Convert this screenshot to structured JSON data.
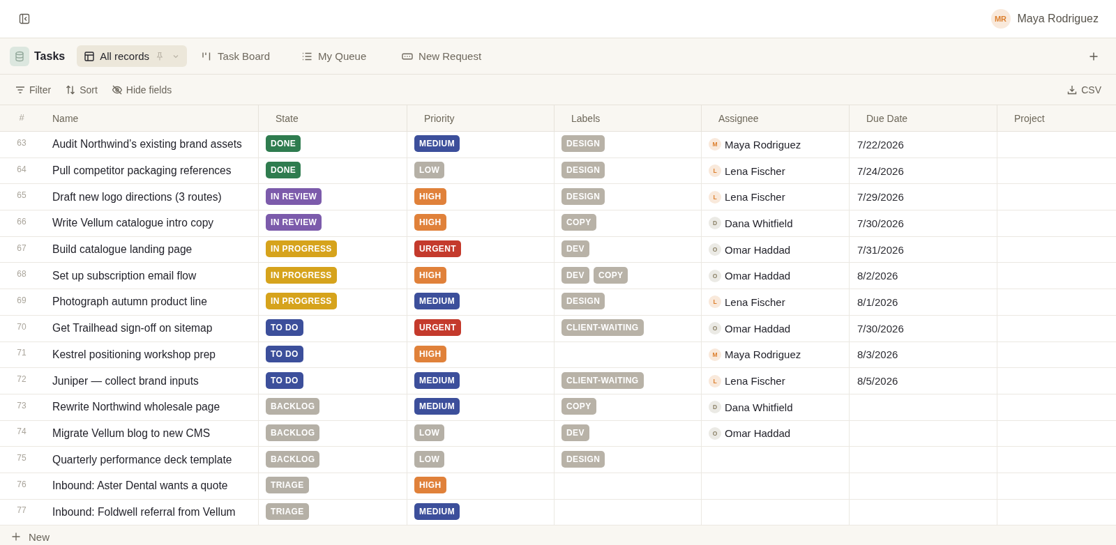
{
  "top_bar": {
    "user": {
      "initials": "MR",
      "name": "Maya Rodriguez",
      "color": "#dc7f2e"
    }
  },
  "views": {
    "title": "Tasks",
    "tabs": [
      {
        "label": "All records",
        "kind": "table",
        "selected": true,
        "pinned": true
      },
      {
        "label": "Task Board",
        "kind": "board",
        "selected": false,
        "pinned": false
      },
      {
        "label": "My Queue",
        "kind": "list",
        "selected": false,
        "pinned": false
      },
      {
        "label": "New Request",
        "kind": "form",
        "selected": false,
        "pinned": false
      }
    ]
  },
  "toolbar": {
    "actions": [
      {
        "label": "Filter",
        "kind": "filter"
      },
      {
        "label": "Sort",
        "kind": "sort"
      },
      {
        "label": "Hide fields",
        "kind": "hide"
      }
    ],
    "export_label": "CSV"
  },
  "table": {
    "columns": [
      "#",
      "Name",
      "State",
      "Priority",
      "Labels",
      "Assignee",
      "Due Date",
      "Project"
    ],
    "rows": [
      {
        "number": "63",
        "name": "Audit Northwind’s existing brand assets",
        "state": {
          "text": "DONE",
          "color": "#2f7c4f"
        },
        "priority": {
          "text": "MEDIUM",
          "color": "#3c4f9b"
        },
        "labels": [
          "DESIGN"
        ],
        "assignee": {
          "initial": "M",
          "name": "Maya Rodriguez",
          "color": "#dc7f2e"
        },
        "due_date": "7/22/2026"
      },
      {
        "number": "64",
        "name": "Pull competitor packaging references",
        "state": {
          "text": "DONE",
          "color": "#2f7c4f"
        },
        "priority": {
          "text": "LOW",
          "color": "#b5b0a6"
        },
        "labels": [
          "DESIGN"
        ],
        "assignee": {
          "initial": "L",
          "name": "Lena Fischer",
          "color": "#dc7f2e"
        },
        "due_date": "7/24/2026"
      },
      {
        "number": "65",
        "name": "Draft new logo directions (3 routes)",
        "state": {
          "text": "IN REVIEW",
          "color": "#7c5bab"
        },
        "priority": {
          "text": "HIGH",
          "color": "#e0813a"
        },
        "labels": [
          "DESIGN"
        ],
        "assignee": {
          "initial": "L",
          "name": "Lena Fischer",
          "color": "#dc7f2e"
        },
        "due_date": "7/29/2026"
      },
      {
        "number": "66",
        "name": "Write Vellum catalogue intro copy",
        "state": {
          "text": "IN REVIEW",
          "color": "#7c5bab"
        },
        "priority": {
          "text": "HIGH",
          "color": "#e0813a"
        },
        "labels": [
          "COPY"
        ],
        "assignee": {
          "initial": "D",
          "name": "Dana Whitfield",
          "color": "#8c8268"
        },
        "due_date": "7/30/2026"
      },
      {
        "number": "67",
        "name": "Build catalogue landing page",
        "state": {
          "text": "IN PROGRESS",
          "color": "#d6a31c"
        },
        "priority": {
          "text": "URGENT",
          "color": "#c43a2c"
        },
        "labels": [
          "DEV"
        ],
        "assignee": {
          "initial": "O",
          "name": "Omar Haddad",
          "color": "#8c8268"
        },
        "due_date": "7/31/2026"
      },
      {
        "number": "68",
        "name": "Set up subscription email flow",
        "state": {
          "text": "IN PROGRESS",
          "color": "#d6a31c"
        },
        "priority": {
          "text": "HIGH",
          "color": "#e0813a"
        },
        "labels": [
          "DEV",
          "COPY"
        ],
        "assignee": {
          "initial": "O",
          "name": "Omar Haddad",
          "color": "#8c8268"
        },
        "due_date": "8/2/2026"
      },
      {
        "number": "69",
        "name": "Photograph autumn product line",
        "state": {
          "text": "IN PROGRESS",
          "color": "#d6a31c"
        },
        "priority": {
          "text": "MEDIUM",
          "color": "#3c4f9b"
        },
        "labels": [
          "DESIGN"
        ],
        "assignee": {
          "initial": "L",
          "name": "Lena Fischer",
          "color": "#dc7f2e"
        },
        "due_date": "8/1/2026"
      },
      {
        "number": "70",
        "name": "Get Trailhead sign-off on sitemap",
        "state": {
          "text": "TO DO",
          "color": "#3c4f9b"
        },
        "priority": {
          "text": "URGENT",
          "color": "#c43a2c"
        },
        "labels": [
          "CLIENT-WAITING"
        ],
        "assignee": {
          "initial": "O",
          "name": "Omar Haddad",
          "color": "#8c8268"
        },
        "due_date": "7/30/2026"
      },
      {
        "number": "71",
        "name": "Kestrel positioning workshop prep",
        "state": {
          "text": "TO DO",
          "color": "#3c4f9b"
        },
        "priority": {
          "text": "HIGH",
          "color": "#e0813a"
        },
        "assignee": {
          "initial": "M",
          "name": "Maya Rodriguez",
          "color": "#dc7f2e"
        },
        "due_date": "8/3/2026"
      },
      {
        "number": "72",
        "name": "Juniper — collect brand inputs",
        "state": {
          "text": "TO DO",
          "color": "#3c4f9b"
        },
        "priority": {
          "text": "MEDIUM",
          "color": "#3c4f9b"
        },
        "labels": [
          "CLIENT-WAITING"
        ],
        "assignee": {
          "initial": "L",
          "name": "Lena Fischer",
          "color": "#dc7f2e"
        },
        "due_date": "8/5/2026"
      },
      {
        "number": "73",
        "name": "Rewrite Northwind wholesale page",
        "state": {
          "text": "BACKLOG",
          "color": "#b5b0a6"
        },
        "priority": {
          "text": "MEDIUM",
          "color": "#3c4f9b"
        },
        "labels": [
          "COPY"
        ],
        "assignee": {
          "initial": "D",
          "name": "Dana Whitfield",
          "color": "#8c8268"
        }
      },
      {
        "number": "74",
        "name": "Migrate Vellum blog to new CMS",
        "state": {
          "text": "BACKLOG",
          "color": "#b5b0a6"
        },
        "priority": {
          "text": "LOW",
          "color": "#b5b0a6"
        },
        "labels": [
          "DEV"
        ],
        "assignee": {
          "initial": "O",
          "name": "Omar Haddad",
          "color": "#8c8268"
        }
      },
      {
        "number": "75",
        "name": "Quarterly performance deck template",
        "state": {
          "text": "BACKLOG",
          "color": "#b5b0a6"
        },
        "priority": {
          "text": "LOW",
          "color": "#b5b0a6"
        },
        "labels": [
          "DESIGN"
        ]
      },
      {
        "number": "76",
        "name": "Inbound: Aster Dental wants a quote",
        "state": {
          "text": "TRIAGE",
          "color": "#b5b0a6"
        },
        "priority": {
          "text": "HIGH",
          "color": "#e0813a"
        }
      },
      {
        "number": "77",
        "name": "Inbound: Foldwell referral from Vellum",
        "state": {
          "text": "TRIAGE",
          "color": "#b5b0a6"
        },
        "priority": {
          "text": "MEDIUM",
          "color": "#3c4f9b"
        }
      }
    ]
  },
  "footer": {
    "new_label": "New"
  }
}
